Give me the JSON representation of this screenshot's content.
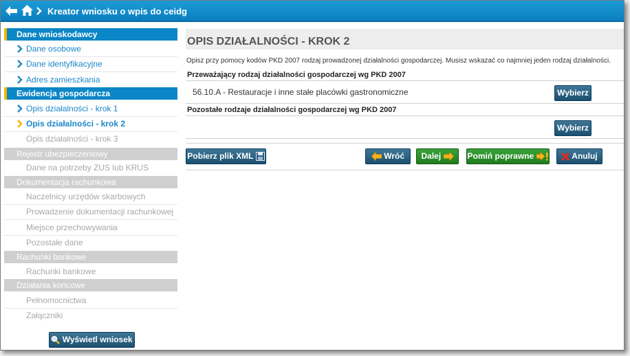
{
  "header": {
    "title": "Kreator wniosku o wpis do ceidg"
  },
  "sidebar": {
    "sections": [
      {
        "label": "Dane wnioskodawcy",
        "items": [
          "Dane osobowe",
          "Dane identyfikacyjne",
          "Adres zamieszkania"
        ]
      },
      {
        "label": "Ewidencja gospodarcza",
        "items": [
          "Opis działalności - krok 1",
          "Opis działalności - krok 2",
          "Opis działalności - krok 3"
        ]
      },
      {
        "label": "Rejestr ubezpieczeniowy",
        "items": [
          "Dane na potrzeby ZUS lub KRUS"
        ]
      },
      {
        "label": "Dokumentacja rachunkowa",
        "items": [
          "Naczelnicy urzędów skarbowych",
          "Prowadzenie dokumentacji rachunkowej",
          "Miejsce przechowywania",
          "Pozostałe dane"
        ]
      },
      {
        "label": "Rachunki bankowe",
        "items": [
          "Rachunki bankowe"
        ]
      },
      {
        "label": "Działania końcowe",
        "items": [
          "Pełnomocnictwa",
          "Załączniki"
        ]
      }
    ],
    "view_button": "Wyświetl wniosek"
  },
  "main": {
    "title": "OPIS DZIAŁALNOŚCI - KROK 2",
    "description": "Opisz przy pomocy kodów PKD 2007 rodzaj prowadzonej działalności gospodarczej. Musisz wskazać co najmniej jeden rodzaj działalności.",
    "primary_header": "Przeważający rodzaj działalności gospodarczej wg PKD 2007",
    "primary_value": "56.10.A - Restauracje i inne stałe placówki gastronomiczne",
    "other_header": "Pozostałe rodzaje działalności gospodarczej wg PKD 2007",
    "choose_label": "Wybierz"
  },
  "actions": {
    "download_xml": "Pobierz plik XML",
    "back": "Wróć",
    "next": "Dalej",
    "skip_valid": "Pomiń poprawne",
    "cancel": "Anuluj"
  },
  "colors": {
    "topbar": "#0a7fc0",
    "active_section": "#0b86c6",
    "accent_marker": "#f7b500",
    "link": "#1b86c8",
    "dark_button": "#1c4f6f",
    "green_button": "#1f7d1f"
  }
}
